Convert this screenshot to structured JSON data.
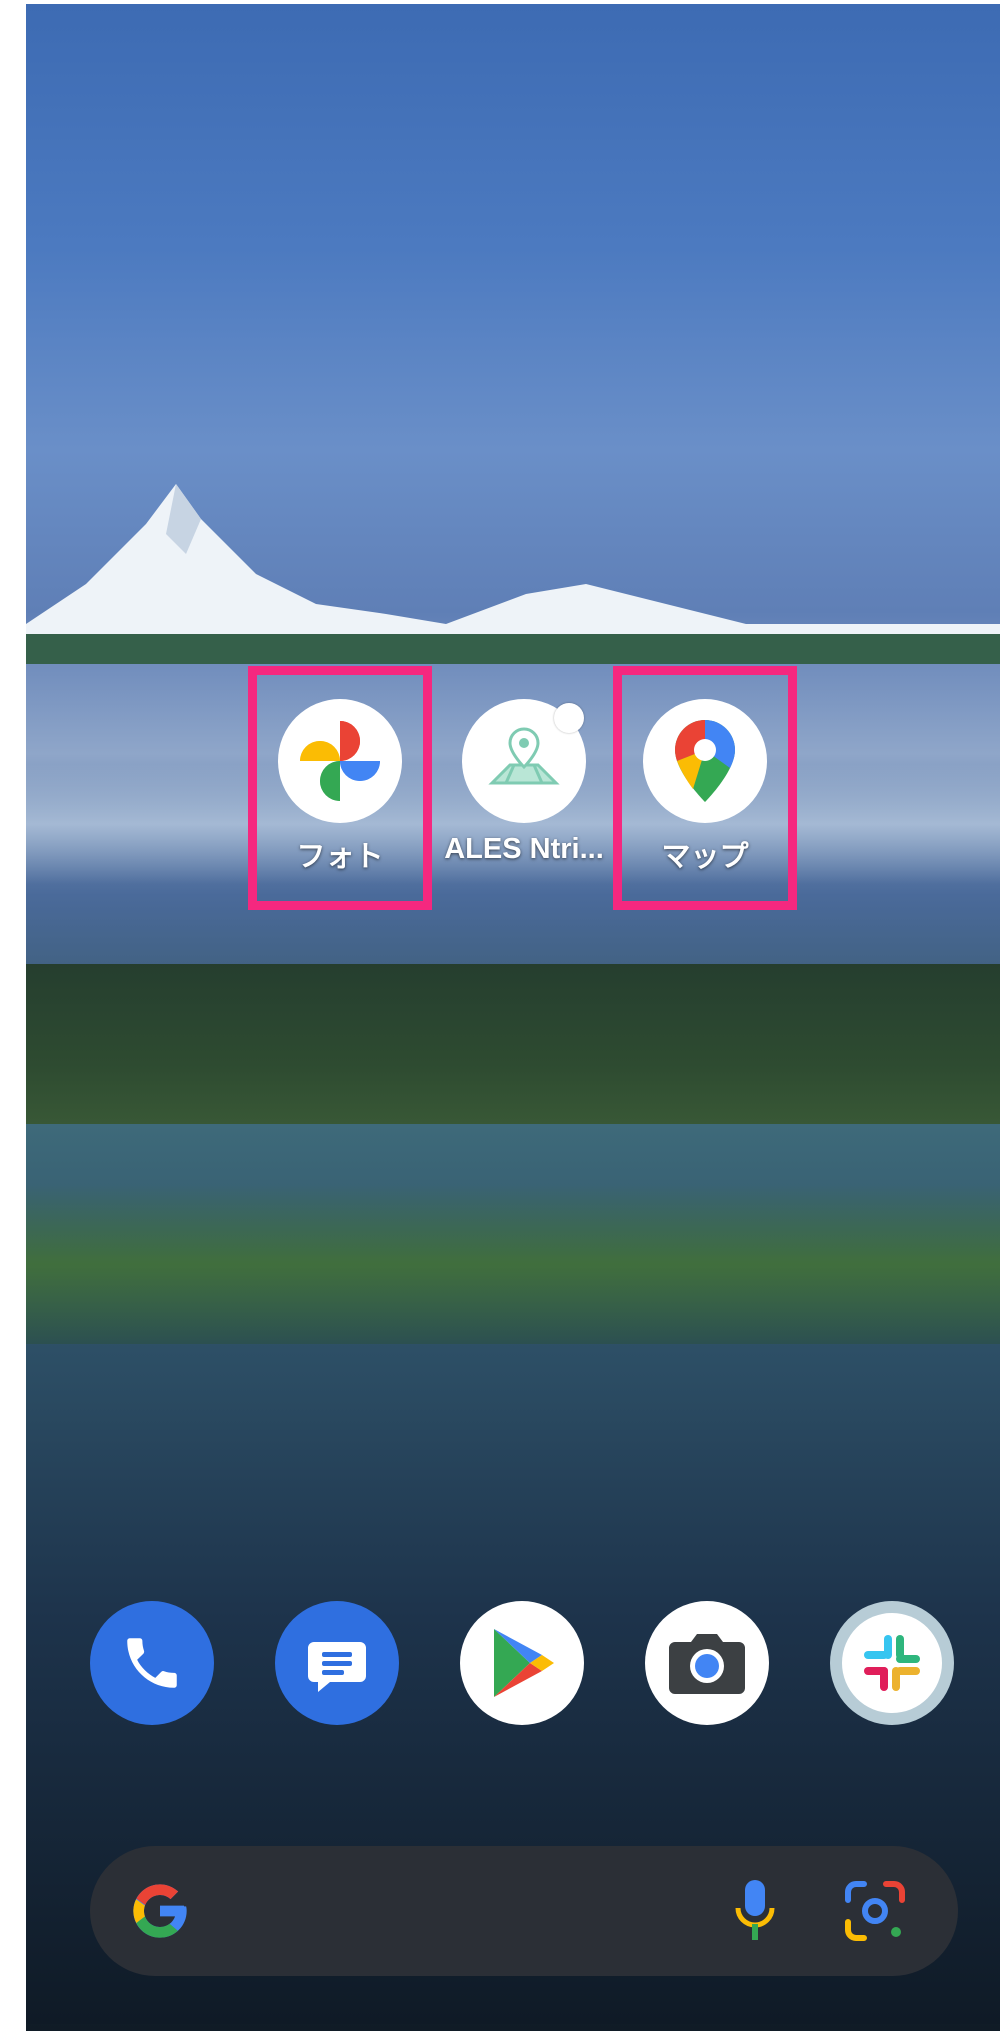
{
  "home_apps": [
    {
      "label": "フォト",
      "icon": "google-photos-icon",
      "highlighted": true
    },
    {
      "label": "ALES Ntri...",
      "icon": "ales-map-icon",
      "highlighted": false,
      "notification_dot": true
    },
    {
      "label": "マップ",
      "icon": "google-maps-icon",
      "highlighted": true
    }
  ],
  "dock": [
    {
      "icon": "phone-icon",
      "color": "#2f6fe0"
    },
    {
      "icon": "messages-icon",
      "color": "#2f6fe0"
    },
    {
      "icon": "play-store-icon",
      "color": "#ffffff"
    },
    {
      "icon": "camera-icon",
      "color": "#ffffff"
    },
    {
      "icon": "slack-icon",
      "color": "#b7ccd6"
    }
  ],
  "search_bar": {
    "icons": [
      "google-g-icon",
      "microphone-icon",
      "google-lens-icon"
    ]
  },
  "colors": {
    "highlight": "#f5287f"
  }
}
